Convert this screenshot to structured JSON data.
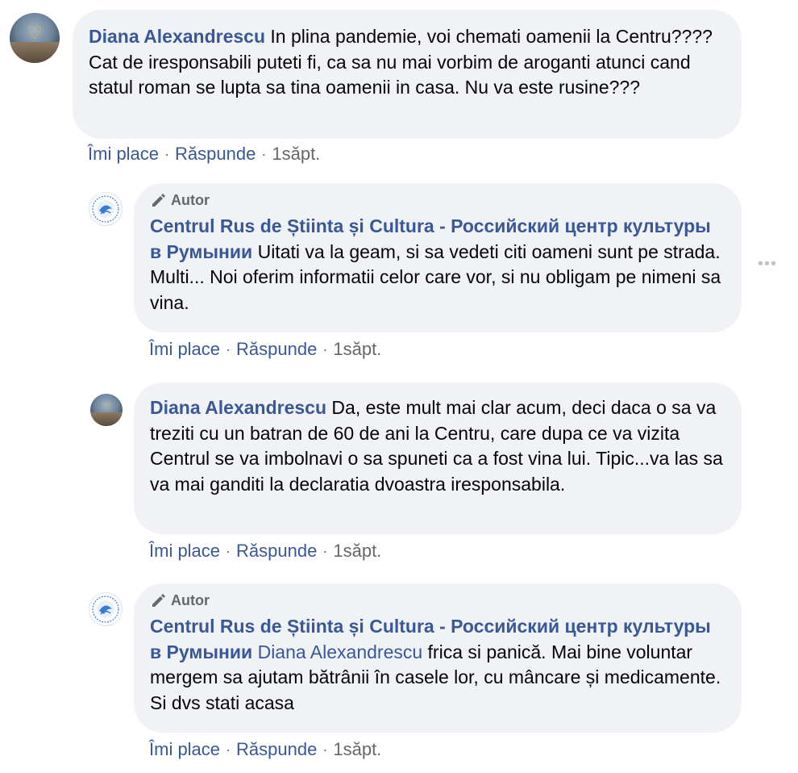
{
  "actions": {
    "like": "Îmi place",
    "reply": "Răspunde",
    "separator": "·",
    "time": "1săpt."
  },
  "author_badge": "Autor",
  "more_options": "•••",
  "comments": [
    {
      "author": "Diana Alexandrescu",
      "text": "In plina pandemie, voi chemati oamenii la Centru????Cat de iresponsabili puteti fi, ca sa nu mai vorbim de aroganti atunci cand statul roman se lupta sa tina oamenii in casa. Nu va este rusine???"
    },
    {
      "author": "Centrul Rus de Știinta și Cultura - Российский центр культуры в Румынии",
      "text": "Uitati va la geam, si sa vedeti citi oameni sunt pe strada. Multi... Noi oferim informatii celor care vor, si nu obligam pe nimeni sa vina."
    },
    {
      "author": "Diana Alexandrescu",
      "text": "Da, este mult mai clar acum, deci daca o sa va treziti cu un batran de 60 de ani la Centru, care dupa ce va vizita Centrul se va imbolnavi o sa spuneti ca a fost vina lui. Tipic...va las sa va mai ganditi la declaratia dvoastra iresponsabila."
    },
    {
      "author": "Centrul Rus de Știinta și Cultura - Российский центр культуры в Румынии",
      "mention": "Diana Alexandrescu",
      "text": "frica si panică. Mai bine voluntar mergem sa ajutam bătrânii în casele lor, cu mâncare și medicamente. Si dvs stati acasa"
    }
  ]
}
